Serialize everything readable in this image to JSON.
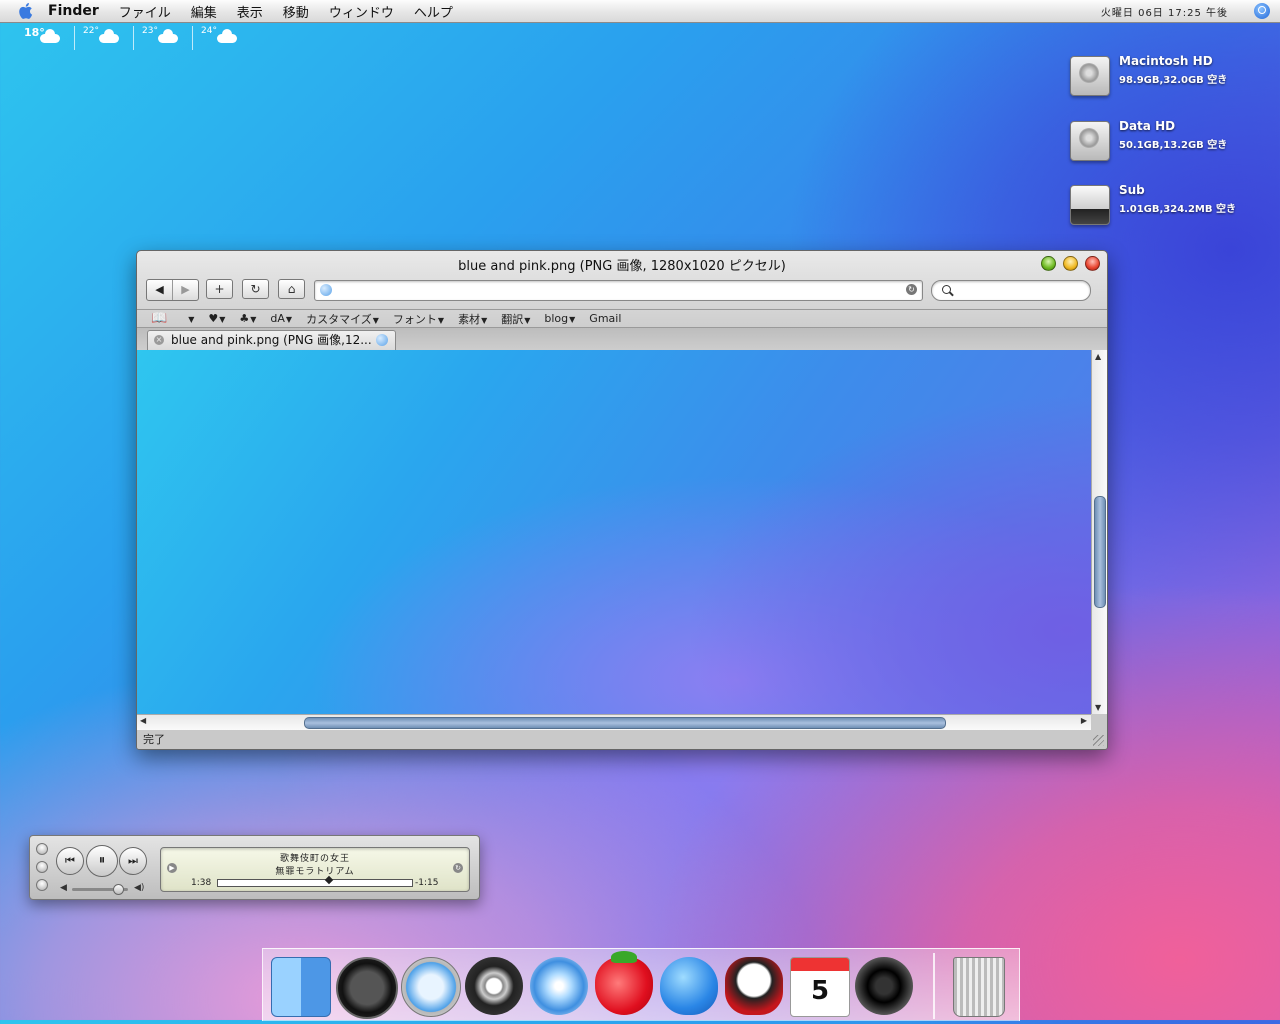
{
  "menubar": {
    "apple_icon": "apple-logo",
    "app_name": "Finder",
    "items": [
      "ファイル",
      "編集",
      "表示",
      "移動",
      "ウィンドウ",
      "ヘルプ"
    ],
    "clock": "火曜日 06日 17:25 午後"
  },
  "weather": [
    {
      "temp": "18°"
    },
    {
      "temp": "22°"
    },
    {
      "temp": "23°"
    },
    {
      "temp": "24°"
    }
  ],
  "desktop_icons": [
    {
      "name": "Macintosh HD",
      "info": "98.9GB,32.0GB 空き"
    },
    {
      "name": "Data HD",
      "info": "50.1GB,13.2GB 空き"
    },
    {
      "name": "Sub",
      "info": "1.01GB,324.2MB 空き"
    }
  ],
  "browser": {
    "title": "blue and pink.png (PNG 画像, 1280x1020 ピクセル)",
    "back_label": "◀",
    "forward_label": "▶",
    "add_label": "+",
    "reload_label": "↻",
    "home_label": "⌂",
    "url_value": "",
    "search_value": "",
    "bookmarks": [
      {
        "label": "",
        "icon": "apple-icon"
      },
      {
        "label": "",
        "icon": "heart-icon"
      },
      {
        "label": "",
        "icon": "club-icon"
      },
      {
        "label": "dA"
      },
      {
        "label": "カスタマイズ"
      },
      {
        "label": "フォント"
      },
      {
        "label": "素材"
      },
      {
        "label": "翻訳"
      },
      {
        "label": "blog"
      },
      {
        "label": "Gmail"
      }
    ],
    "tab_label": "blue and pink.png  (PNG 画像,12...",
    "status": "完了",
    "vscroll_position": 0.42,
    "hscroll_position": 0.25
  },
  "itunes": {
    "track_title": "歌舞伎町の女王",
    "album": "無罪モラトリアム",
    "elapsed": "1:38",
    "remaining": "-1:15",
    "progress": 0.57,
    "volume": 0.8
  },
  "dock": {
    "apps": [
      "finder-icon",
      "dashboard-icon",
      "safari-icon",
      "bittorrent-icon",
      "itunes-icon",
      "strawberry-icon",
      "slime-icon",
      "bird-icon",
      "ical-icon",
      "camera-icon"
    ],
    "ical_day": "5",
    "trash": "trash-icon"
  },
  "colors": {
    "desktop_top": "#2ec5ee",
    "desktop_bottom_right": "#f0609a",
    "scroll_thumb": "#8aa6c8"
  }
}
